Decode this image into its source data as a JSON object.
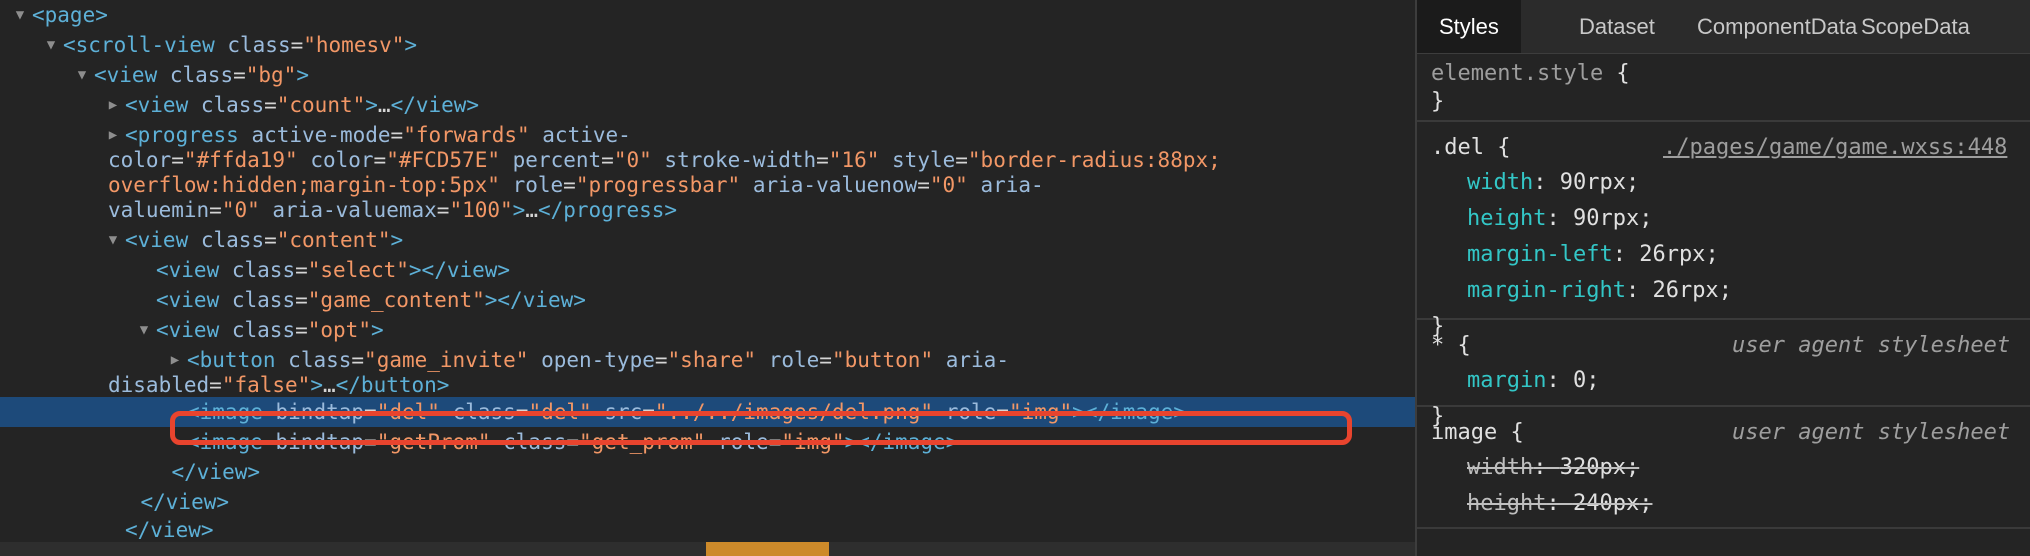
{
  "tree": {
    "rows": [
      {
        "indent": 0,
        "tri": "▼",
        "segs": [
          [
            "tag",
            "<page>"
          ]
        ]
      },
      {
        "indent": 1,
        "tri": "▼",
        "segs": [
          [
            "tag",
            "<scroll-view"
          ],
          [
            "sp",
            " "
          ],
          [
            "attr",
            "class"
          ],
          [
            "eq",
            "="
          ],
          [
            "val",
            "\"homesv\""
          ],
          [
            "tag",
            ">"
          ]
        ]
      },
      {
        "indent": 2,
        "tri": "▼",
        "segs": [
          [
            "tag",
            "<view"
          ],
          [
            "sp",
            " "
          ],
          [
            "attr",
            "class"
          ],
          [
            "eq",
            "="
          ],
          [
            "val",
            "\"bg\""
          ],
          [
            "tag",
            ">"
          ]
        ]
      },
      {
        "indent": 3,
        "tri": "▶",
        "segs": [
          [
            "tag",
            "<view"
          ],
          [
            "sp",
            " "
          ],
          [
            "attr",
            "class"
          ],
          [
            "eq",
            "="
          ],
          [
            "val",
            "\"count\""
          ],
          [
            "tag",
            ">"
          ],
          [
            "ell",
            "…"
          ],
          [
            "tag",
            "</view>"
          ]
        ]
      },
      {
        "indent": 3,
        "tri": "▶",
        "segs": [
          [
            "tag",
            "<progress"
          ],
          [
            "sp",
            " "
          ],
          [
            "attr",
            "active-mode"
          ],
          [
            "eq",
            "="
          ],
          [
            "val",
            "\"forwards\""
          ],
          [
            "sp",
            " "
          ],
          [
            "attr",
            "active-"
          ]
        ]
      },
      {
        "indent": "wrap",
        "tri": "",
        "segs": [
          [
            "attr",
            "color"
          ],
          [
            "eq",
            "="
          ],
          [
            "val",
            "\"#ffda19\""
          ],
          [
            "sp",
            " "
          ],
          [
            "attr",
            "color"
          ],
          [
            "eq",
            "="
          ],
          [
            "val",
            "\"#FCD57E\""
          ],
          [
            "sp",
            " "
          ],
          [
            "attr",
            "percent"
          ],
          [
            "eq",
            "="
          ],
          [
            "val",
            "\"0\""
          ],
          [
            "sp",
            " "
          ],
          [
            "attr",
            "stroke-width"
          ],
          [
            "eq",
            "="
          ],
          [
            "val",
            "\"16\""
          ],
          [
            "sp",
            " "
          ],
          [
            "attr",
            "style"
          ],
          [
            "eq",
            "="
          ],
          [
            "val",
            "\"border-radius:88px;"
          ]
        ]
      },
      {
        "indent": "wrap",
        "tri": "",
        "segs": [
          [
            "val",
            "overflow:hidden;margin-top:5px\""
          ],
          [
            "sp",
            " "
          ],
          [
            "attr",
            "role"
          ],
          [
            "eq",
            "="
          ],
          [
            "val",
            "\"progressbar\""
          ],
          [
            "sp",
            " "
          ],
          [
            "attr",
            "aria-valuenow"
          ],
          [
            "eq",
            "="
          ],
          [
            "val",
            "\"0\""
          ],
          [
            "sp",
            " "
          ],
          [
            "attr",
            "aria-"
          ]
        ]
      },
      {
        "indent": "wrap",
        "tri": "",
        "segs": [
          [
            "attr",
            "valuemin"
          ],
          [
            "eq",
            "="
          ],
          [
            "val",
            "\"0\""
          ],
          [
            "sp",
            " "
          ],
          [
            "attr",
            "aria-valuemax"
          ],
          [
            "eq",
            "="
          ],
          [
            "val",
            "\"100\""
          ],
          [
            "tag",
            ">"
          ],
          [
            "ell",
            "…"
          ],
          [
            "tag",
            "</progress>"
          ]
        ]
      },
      {
        "indent": 3,
        "tri": "▼",
        "segs": [
          [
            "tag",
            "<view"
          ],
          [
            "sp",
            " "
          ],
          [
            "attr",
            "class"
          ],
          [
            "eq",
            "="
          ],
          [
            "val",
            "\"content\""
          ],
          [
            "tag",
            ">"
          ]
        ]
      },
      {
        "indent": 4,
        "tri": "",
        "segs": [
          [
            "tag",
            "<view"
          ],
          [
            "sp",
            " "
          ],
          [
            "attr",
            "class"
          ],
          [
            "eq",
            "="
          ],
          [
            "val",
            "\"select\""
          ],
          [
            "tag",
            "></view>"
          ]
        ]
      },
      {
        "indent": 4,
        "tri": "",
        "segs": [
          [
            "tag",
            "<view"
          ],
          [
            "sp",
            " "
          ],
          [
            "attr",
            "class"
          ],
          [
            "eq",
            "="
          ],
          [
            "val",
            "\"game_content\""
          ],
          [
            "tag",
            "></view>"
          ]
        ]
      },
      {
        "indent": 4,
        "tri": "▼",
        "segs": [
          [
            "tag",
            "<view"
          ],
          [
            "sp",
            " "
          ],
          [
            "attr",
            "class"
          ],
          [
            "eq",
            "="
          ],
          [
            "val",
            "\"opt\""
          ],
          [
            "tag",
            ">"
          ]
        ]
      },
      {
        "indent": 5,
        "tri": "▶",
        "segs": [
          [
            "tag",
            "<button"
          ],
          [
            "sp",
            " "
          ],
          [
            "attr",
            "class"
          ],
          [
            "eq",
            "="
          ],
          [
            "val",
            "\"game_invite\""
          ],
          [
            "sp",
            " "
          ],
          [
            "attr",
            "open-type"
          ],
          [
            "eq",
            "="
          ],
          [
            "val",
            "\"share\""
          ],
          [
            "sp",
            " "
          ],
          [
            "attr",
            "role"
          ],
          [
            "eq",
            "="
          ],
          [
            "val",
            "\"button\""
          ],
          [
            "sp",
            " "
          ],
          [
            "attr",
            "aria-"
          ]
        ]
      },
      {
        "indent": "wrap",
        "tri": "",
        "segs": [
          [
            "attr",
            "disabled"
          ],
          [
            "eq",
            "="
          ],
          [
            "val",
            "\"false\""
          ],
          [
            "tag",
            ">"
          ],
          [
            "ell",
            "…"
          ],
          [
            "tag",
            "</button>"
          ]
        ]
      },
      {
        "indent": 5,
        "tri": "",
        "selected": true,
        "segs": [
          [
            "tag",
            "<image"
          ],
          [
            "sp",
            " "
          ],
          [
            "attr",
            "bindtap"
          ],
          [
            "eq",
            "="
          ],
          [
            "val",
            "\"del\""
          ],
          [
            "sp",
            " "
          ],
          [
            "attr",
            "class"
          ],
          [
            "eq",
            "="
          ],
          [
            "val",
            "\"del\""
          ],
          [
            "sp",
            " "
          ],
          [
            "attr",
            "src"
          ],
          [
            "eq",
            "="
          ],
          [
            "val",
            "\"../../images/del.png\""
          ],
          [
            "sp",
            " "
          ],
          [
            "attr",
            "role"
          ],
          [
            "eq",
            "="
          ],
          [
            "val",
            "\"img\""
          ],
          [
            "tag",
            "></image>"
          ]
        ]
      },
      {
        "indent": 5,
        "tri": "",
        "segs": [
          [
            "tag",
            "<image"
          ],
          [
            "sp",
            " "
          ],
          [
            "attr",
            "bindtap"
          ],
          [
            "eq",
            "="
          ],
          [
            "val",
            "\"getProm\""
          ],
          [
            "sp",
            " "
          ],
          [
            "attr",
            "class"
          ],
          [
            "eq",
            "="
          ],
          [
            "val",
            "\"get_prom\""
          ],
          [
            "sp",
            " "
          ],
          [
            "attr",
            "role"
          ],
          [
            "eq",
            "="
          ],
          [
            "val",
            "\"img\""
          ],
          [
            "tag",
            "></image>"
          ]
        ]
      },
      {
        "indent": 4.5,
        "tri": "",
        "segs": [
          [
            "tag",
            "</view>"
          ]
        ]
      },
      {
        "indent": 3.5,
        "tri": "",
        "segs": [
          [
            "tag",
            "</view>"
          ]
        ]
      },
      {
        "indent": 3,
        "tri": "",
        "segs": [
          [
            "tag",
            "</view>"
          ]
        ]
      }
    ]
  },
  "styles": {
    "tabs": [
      "Styles",
      "Dataset",
      "ComponentData",
      "ScopeData"
    ],
    "rules": [
      {
        "selector": "element.style",
        "dim": false,
        "source": "",
        "ua": "",
        "props": []
      },
      {
        "selector": ".del",
        "dim": false,
        "source": "./pages/game/game.wxss:448",
        "ua": "",
        "props": [
          [
            "width",
            "90rpx",
            false
          ],
          [
            "height",
            "90rpx",
            false
          ],
          [
            "margin-left",
            "26rpx",
            false
          ],
          [
            "margin-right",
            "26rpx",
            false
          ]
        ]
      },
      {
        "selector": "*",
        "dim": false,
        "source": "",
        "ua": "user agent stylesheet",
        "props": [
          [
            "margin",
            "0",
            false
          ]
        ]
      },
      {
        "selector": "image",
        "dim": false,
        "source": "",
        "ua": "user agent stylesheet",
        "props": [
          [
            "width",
            "320px",
            true
          ],
          [
            "height",
            "240px",
            true
          ]
        ]
      }
    ]
  }
}
